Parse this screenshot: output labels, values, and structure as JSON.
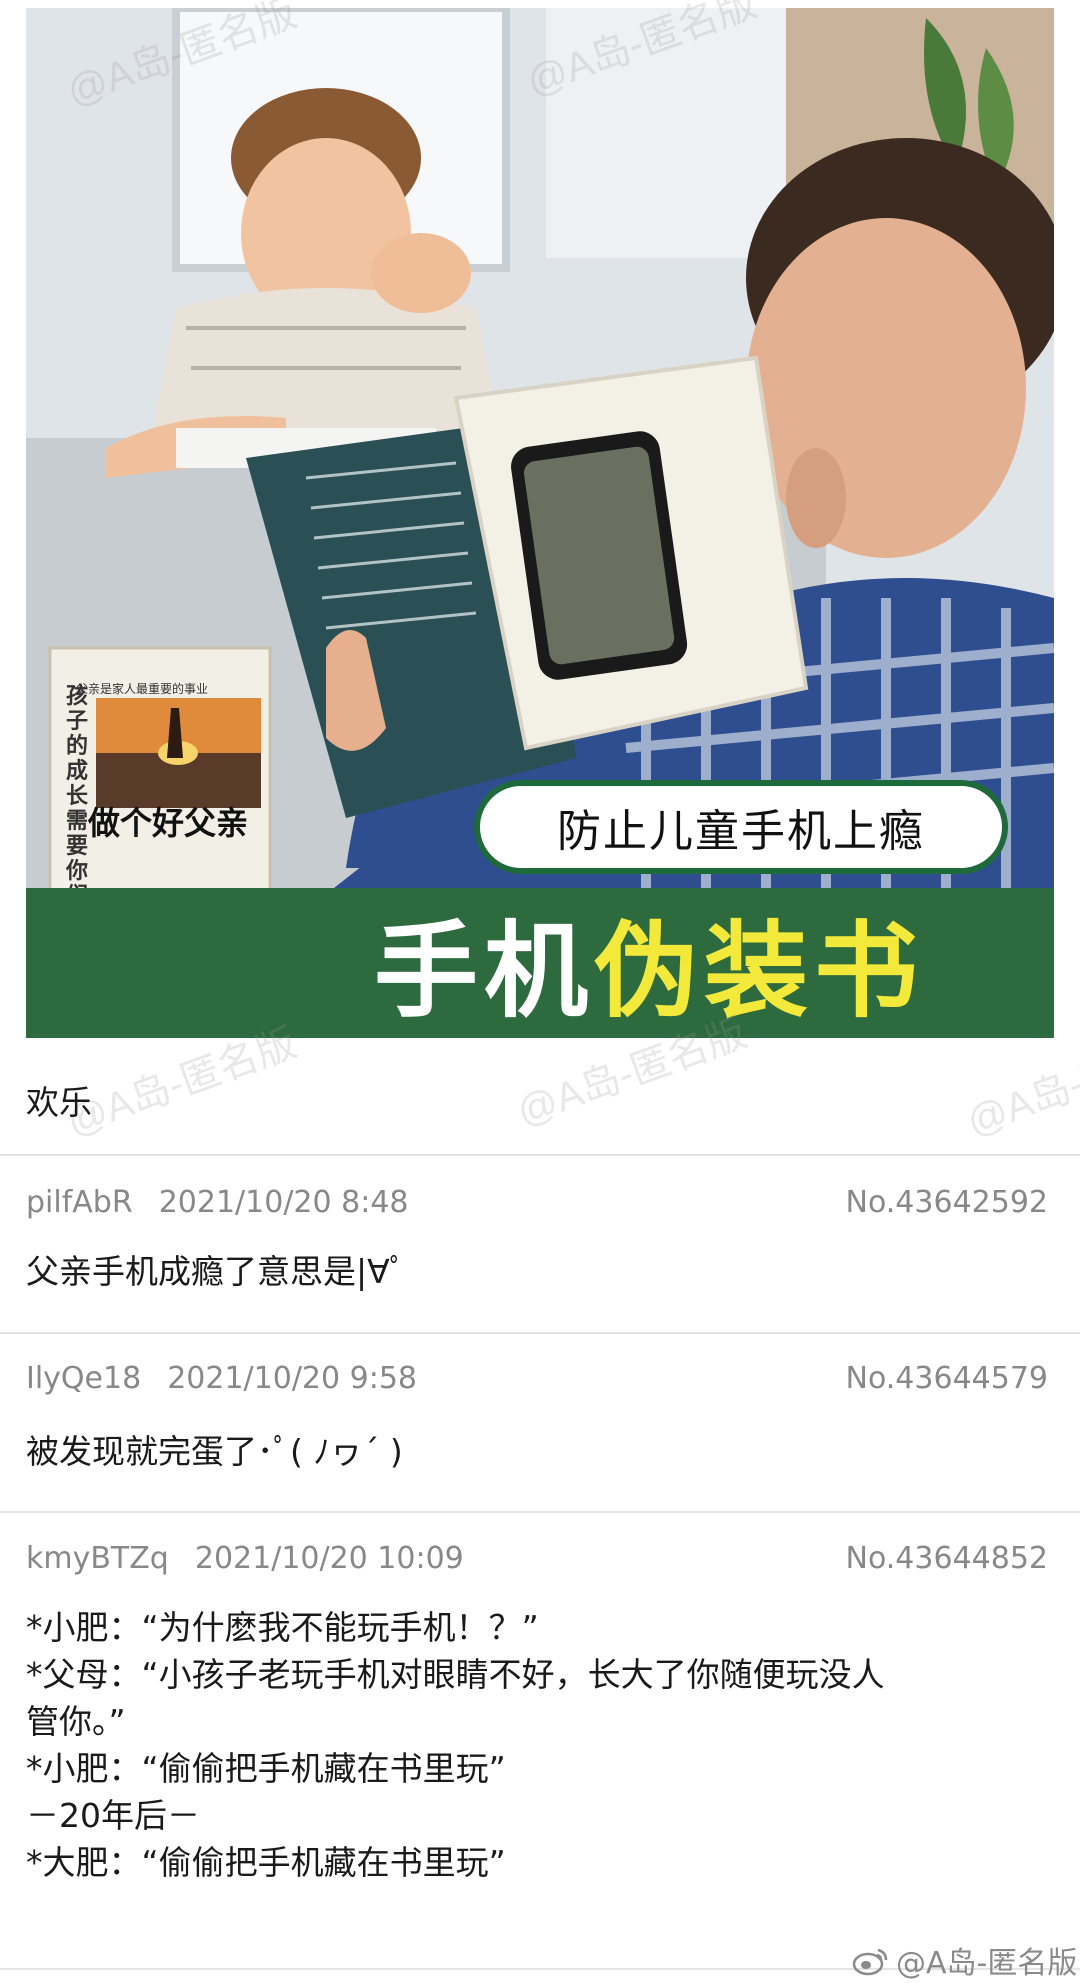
{
  "ad": {
    "badge": "防止儿童手机上瘾",
    "title_part1": "手机",
    "title_highlight": "伪装书",
    "book_title": "做个好父亲",
    "book_vertical": "孩子的成长需要你们的陪伴",
    "book_tag": "父亲是家人最重要的事业"
  },
  "watermark": "@A岛-匿名版",
  "op": {
    "text": "欢乐"
  },
  "replies": [
    {
      "user": "pilfAbR",
      "time": "2021/10/20 8:48",
      "no": "No.43642592",
      "lines": [
        "父亲手机成瘾了意思是|∀ﾟ"
      ]
    },
    {
      "user": "IlyQe18",
      "time": "2021/10/20 9:58",
      "no": "No.43644579",
      "lines": [
        "被发现就完蛋了･ﾟ( ﾉヮ´ )"
      ]
    },
    {
      "user": "kmyBTZq",
      "time": "2021/10/20 10:09",
      "no": "No.43644852",
      "lines": [
        "*小肥：“为什麽我不能玩手机！？”",
        "*父母：“小孩子老玩手机对眼睛不好，长大了你随便玩没人",
        "管你。”",
        "*小肥：“偷偷把手机藏在书里玩”",
        "－20年后－",
        "*大肥：“偷偷把手机藏在书里玩”"
      ]
    }
  ],
  "footer": {
    "icon": "weibo-icon",
    "text": "@A岛-匿名版"
  }
}
